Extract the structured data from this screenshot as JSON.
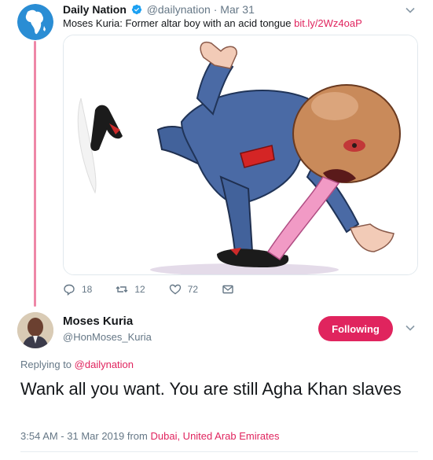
{
  "tweet1": {
    "name": "Daily Nation",
    "handle": "@dailynation",
    "separator": "·",
    "date": "Mar 31",
    "text": "Moses Kuria: Former altar boy with an acid tongue ",
    "link": "bit.ly/2Wz4oaP",
    "actions": {
      "replies": "18",
      "retweets": "12",
      "likes": "72"
    },
    "media_icon": "cartoon-image"
  },
  "tweet2": {
    "name": "Moses Kuria",
    "handle": "@HonMoses_Kuria",
    "follow_label": "Following",
    "replying_prefix": "Replying to ",
    "replying_to": "@dailynation",
    "text": "Wank all you want. You are still Agha Khan slaves",
    "timestamp": "3:54 AM - 31 Mar 2019",
    "from_word": " from ",
    "location": "Dubai, United Arab Emirates"
  },
  "colors": {
    "accent": "#e0245e",
    "verified": "#1da1f2",
    "muted": "#657786"
  }
}
